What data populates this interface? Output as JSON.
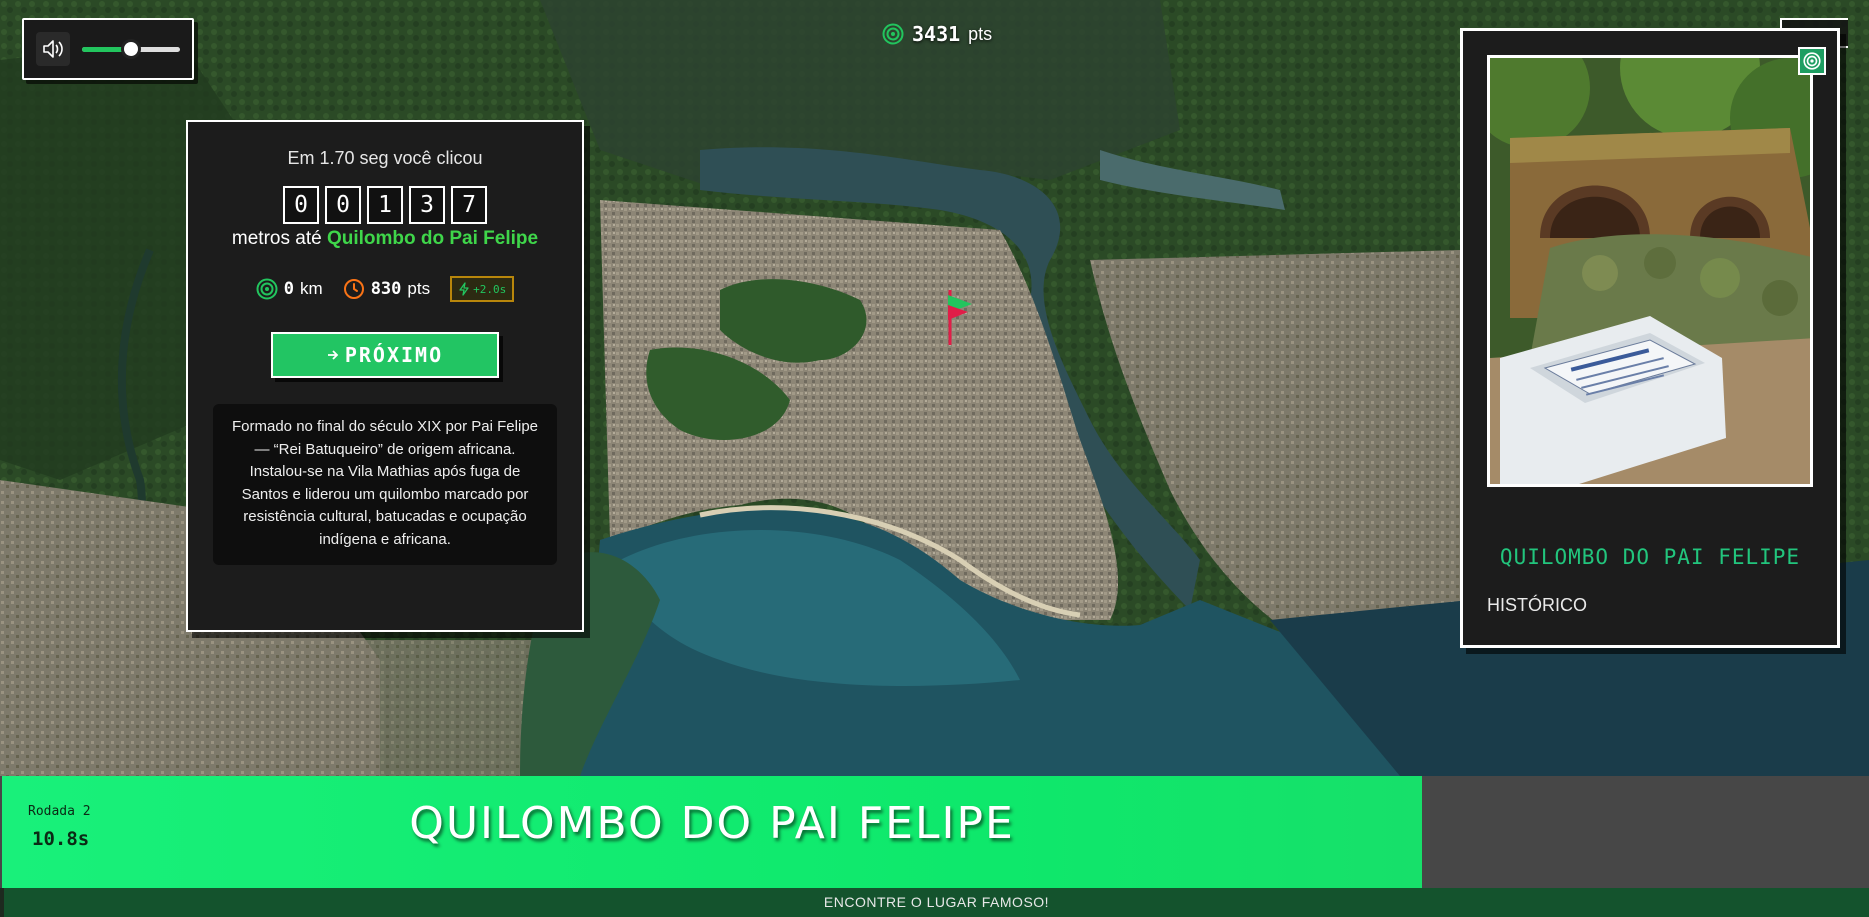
{
  "hud": {
    "sound_icon": "speaker-icon",
    "volume_level": 0.5,
    "total_score_icon": "target-icon",
    "total_score": "3431",
    "total_score_unit": "pts"
  },
  "result": {
    "click_time_text": "Em 1.70 seg você clicou",
    "distance_digits": [
      "0",
      "0",
      "1",
      "3",
      "7"
    ],
    "distance_prefix": "metros até",
    "place_name": "Quilombo do Pai Felipe",
    "km_value": "0",
    "km_unit": "km",
    "points_value": "830",
    "points_unit": "pts",
    "bonus_label": "+2.0s",
    "next_label": "PRÓXIMO",
    "description": "Formado no final do século XIX por Pai Felipe — “Rei Batuqueiro” de origem africana. Instalou-se na Vila Mathias após fuga de Santos e liderou um quilombo marcado por resistência cultural, batucadas e ocupação indígena e africana."
  },
  "card": {
    "title": "QUILOMBO DO PAI FELIPE",
    "category": "HISTÓRICO",
    "badge_icon": "target-icon"
  },
  "banner": {
    "round_label": "Rodada 2",
    "timer": "10.8s",
    "place_title": "QUILOMBO DO PAI FELIPE",
    "instruction": "ENCONTRE O LUGAR FAMOSO!"
  },
  "colors": {
    "accent_green": "#22c55e",
    "banner_green": "#0ee86b",
    "footer_green": "#14532d",
    "panel_bg": "#1c1c1c"
  }
}
